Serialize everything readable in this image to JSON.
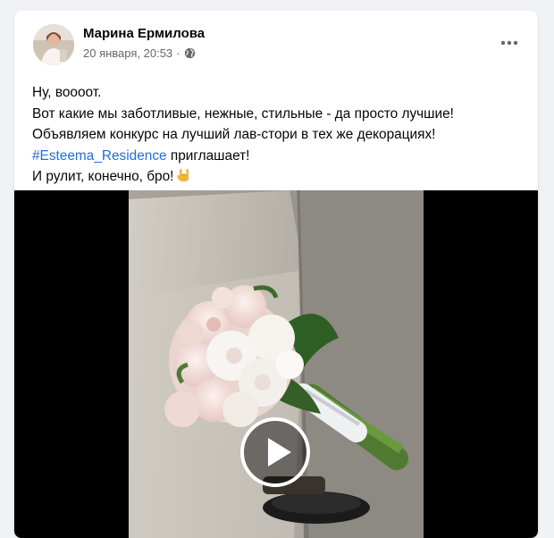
{
  "post": {
    "author": "Марина Ермилова",
    "date": "20 января, 20:53",
    "separator": "·",
    "privacy_icon": "globe-icon",
    "more_icon": "more-horizontal-icon",
    "lines": {
      "line1": "Ну, воооот.",
      "line2": "Вот какие мы заботливые, нежные, стильные - да просто лучшие!",
      "line3": "Объявляем конкурс на лучший лав-стори в тех же декорациях!",
      "hashtag": "#Esteema_Residence",
      "line4_rest": " приглашает!",
      "line5": "И рулит, конечно, бро!"
    },
    "emoji": "rock-on-hand-icon"
  },
  "media": {
    "type": "video",
    "play_icon": "play-icon",
    "colors": {
      "background": "#000000",
      "hashtag": "#216fdb",
      "meta": "#65676b"
    }
  }
}
